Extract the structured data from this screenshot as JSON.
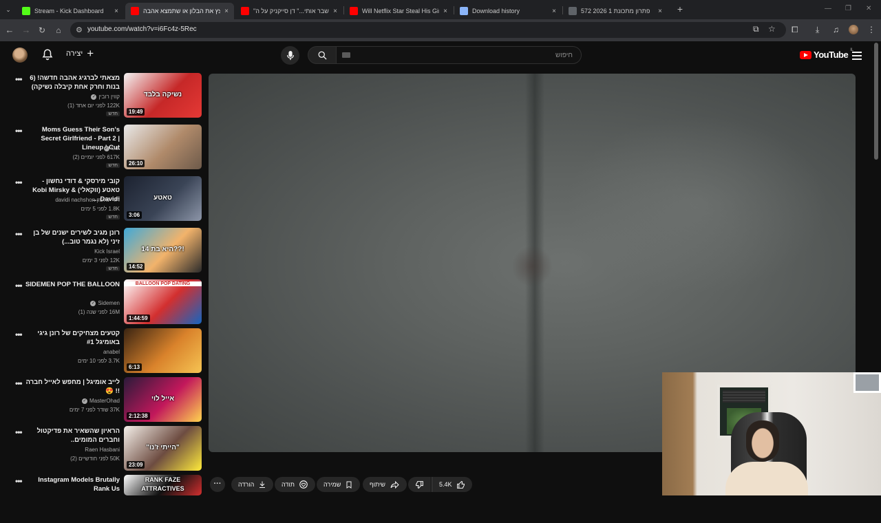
{
  "browser": {
    "tabs": [
      {
        "title": "Stream - Kick Dashboard",
        "icon_color": "#53fc18",
        "active": false
      },
      {
        "title": "פוצץ את הבלון או שתמצא אהבה",
        "icon_color": "#ff0000",
        "active": true
      },
      {
        "title": "\"זה שבר אותי...\" דן סייקניק על ה",
        "icon_color": "#ff0000",
        "active": false
      },
      {
        "title": "Will Netflix Star Steal His Girlfri",
        "icon_color": "#ff0000",
        "active": false
      },
      {
        "title": "Download history",
        "icon_color": "#8ab4f8",
        "active": false
      },
      {
        "title": "פתרון מתכונת 1 2026 572",
        "icon_color": "#5f6368",
        "active": false
      }
    ],
    "tab_close_glyph": "×",
    "new_tab_glyph": "+",
    "url": "youtube.com/watch?v=i6Fc4z-5Rec"
  },
  "masthead": {
    "create_label": "יצירה",
    "search_placeholder": "חיפוש",
    "logo_text": "YouTube",
    "logo_region": "IL"
  },
  "recommendations": [
    {
      "title": "מצאתי לברגיג אהבה חדשה! (6 בנות וחרק אחת קיבלה נשיקה)",
      "channel": "קווין רובין",
      "verified": true,
      "views": "122K",
      "age": "לפני יום אחד (1)",
      "duration": "19:49",
      "badge": "חדש",
      "thumb": [
        "#f3f3f3",
        "#c62828",
        "#e53935"
      ],
      "rtl": true
    },
    {
      "title": "Moms Guess Their Son's Secret Girlfriend - Part 2 | Lineup | Cut",
      "channel": "Cut",
      "verified": true,
      "views": "617K",
      "age": "לפני יומיים (2)",
      "duration": "26:10",
      "badge": "חדש",
      "thumb": [
        "#e9e9e9",
        "#b08a6a",
        "#6d5a4a"
      ],
      "rtl": false
    },
    {
      "title": "קובי מירסקי & דודי נחשון - טאטע (ווקאלי) Kobi Mirsky & Davidi ...",
      "channel": "davidi nachshon דודי נחשון",
      "verified": false,
      "views": "1.8K",
      "age": "לפני 5 ימים",
      "duration": "3:06",
      "badge": "חדש",
      "thumb": [
        "#1c2230",
        "#3a4456",
        "#8c95a8"
      ],
      "rtl": true
    },
    {
      "title": "רונן מגיב לשירים ישנים של בן זיני (לא נגמר טוב...)",
      "channel": "Kick Israel",
      "verified": false,
      "views": "12K",
      "age": "לפני 3 ימים",
      "duration": "14:52",
      "badge": "חדש",
      "thumb": [
        "#3fa9d8",
        "#f2b36b",
        "#2b2b2b"
      ],
      "rtl": true
    },
    {
      "title": "SIDEMEN POP THE BALLOON",
      "channel": "Sidemen",
      "verified": true,
      "views": "16M",
      "age": "לפני שנה (1)",
      "duration": "1:44:59",
      "badge": "",
      "thumb": [
        "#ffffff",
        "#d32f2f",
        "#1565c0"
      ],
      "rtl": false
    },
    {
      "title": "קטעים מצחיקים של רונן גיגי באומיגל #1",
      "channel": "anabel",
      "verified": false,
      "views": "3.7K",
      "age": "לפני 10 ימים",
      "duration": "6:13",
      "badge": "",
      "thumb": [
        "#3a2412",
        "#d9822b",
        "#f6c453"
      ],
      "rtl": true
    },
    {
      "title": "לייב אומיגל | מחפש לאייל חברה !! 😍",
      "channel": "MasterOhad",
      "verified": true,
      "views": "37K",
      "age": "שודר לפני 7 ימים",
      "duration": "2:12:38",
      "badge": "",
      "thumb": [
        "#2a1a3a",
        "#c2185b",
        "#ffd54f"
      ],
      "rtl": true
    },
    {
      "title": "הראיון שהשאיר את פדיקטול וחברים המומים..",
      "channel": "Raen Hasbani",
      "verified": false,
      "views": "50K",
      "age": "לפני חודשיים (2)",
      "duration": "23:09",
      "badge": "",
      "thumb": [
        "#f5f0ea",
        "#6d4c41",
        "#ffeb3b"
      ],
      "rtl": true
    },
    {
      "title": "Instagram Models Brutally Rank Us",
      "channel": "",
      "verified": false,
      "views": "",
      "age": "",
      "duration": "",
      "badge": "",
      "thumb": [
        "#ffffff",
        "#111111",
        "#d32f2f"
      ],
      "rtl": false
    }
  ],
  "thumb_labels": {
    "t0": "נשיקה בלבד",
    "t2": "טאטע",
    "t3": "היא בת 14??!",
    "t4": "BALLOON POP DATING",
    "t6": "אייל לוי",
    "t7": "\"הייתי ז'נו\"",
    "t8a": "RANK FAZE",
    "t8b": "ATTRACTIVES"
  },
  "actions": {
    "download": "הורדה",
    "thanks": "תודה",
    "save": "שמירה",
    "share": "שיתוף",
    "like_count": "5.4K"
  }
}
